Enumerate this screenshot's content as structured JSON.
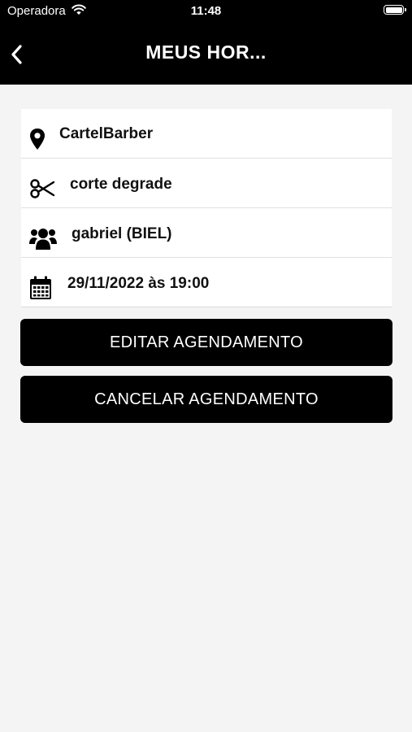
{
  "status_bar": {
    "carrier": "Operadora",
    "time": "11:48"
  },
  "header": {
    "title": "MEUS HOR...",
    "back_icon": "chevron-left-icon"
  },
  "details": {
    "location": {
      "icon": "map-pin-icon",
      "text": "CartelBarber"
    },
    "service": {
      "icon": "scissors-icon",
      "text": "corte degrade"
    },
    "professional": {
      "icon": "users-icon",
      "text": "gabriel (BIEL)"
    },
    "datetime": {
      "icon": "calendar-icon",
      "text": "29/11/2022 às 19:00"
    }
  },
  "actions": {
    "edit_label": "EDITAR AGENDAMENTO",
    "cancel_label": "CANCELAR AGENDAMENTO"
  },
  "colors": {
    "header_bg": "#000000",
    "page_bg": "#f4f4f4",
    "button_bg": "#000000"
  }
}
